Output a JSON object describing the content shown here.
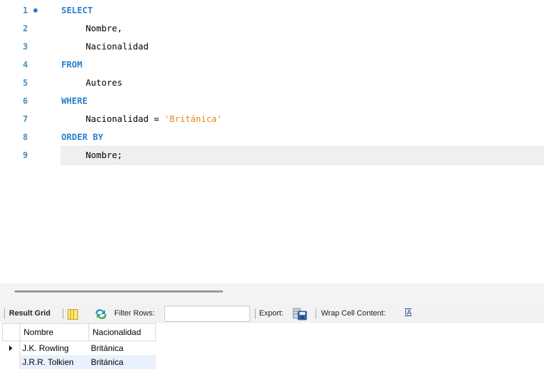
{
  "editor": {
    "lines": [
      {
        "num": "1",
        "tokens": [
          {
            "t": "SELECT",
            "k": "kw"
          }
        ],
        "indent": false
      },
      {
        "num": "2",
        "tokens": [
          {
            "t": "Nombre,",
            "k": "plain"
          }
        ],
        "indent": true
      },
      {
        "num": "3",
        "tokens": [
          {
            "t": "Nacionalidad",
            "k": "plain"
          }
        ],
        "indent": true
      },
      {
        "num": "4",
        "tokens": [
          {
            "t": "FROM",
            "k": "kw"
          }
        ],
        "indent": false
      },
      {
        "num": "5",
        "tokens": [
          {
            "t": "Autores",
            "k": "plain"
          }
        ],
        "indent": true
      },
      {
        "num": "6",
        "tokens": [
          {
            "t": "WHERE",
            "k": "kw"
          }
        ],
        "indent": false
      },
      {
        "num": "7",
        "tokens": [
          {
            "t": "Nacionalidad = ",
            "k": "plain"
          },
          {
            "t": "'Británica'",
            "k": "str"
          }
        ],
        "indent": true
      },
      {
        "num": "8",
        "tokens": [
          {
            "t": "ORDER BY",
            "k": "kw"
          }
        ],
        "indent": false
      },
      {
        "num": "9",
        "tokens": [
          {
            "t": "Nombre;",
            "k": "plain"
          }
        ],
        "indent": true
      }
    ],
    "active_line": "1",
    "current_line": "9",
    "colors": {
      "keyword": "#2a7fcb",
      "string": "#e08a1e",
      "line_number": "#4a8db5"
    }
  },
  "toolbar": {
    "result_grid_label": "Result Grid",
    "filter_label": "Filter Rows:",
    "filter_value": "",
    "export_label": "Export:",
    "wrap_label": "Wrap Cell Content:",
    "wrap_icon_text": "IA",
    "icons": [
      "grid-layout-icon",
      "refresh-icon",
      "export-icon",
      "wrap-cell-icon"
    ]
  },
  "grid": {
    "columns": [
      "Nombre",
      "Nacionalidad"
    ],
    "rows": [
      [
        "J.K. Rowling",
        "Británica"
      ],
      [
        "J.R.R. Tolkien",
        "Británica"
      ]
    ],
    "selected_row": 0
  }
}
